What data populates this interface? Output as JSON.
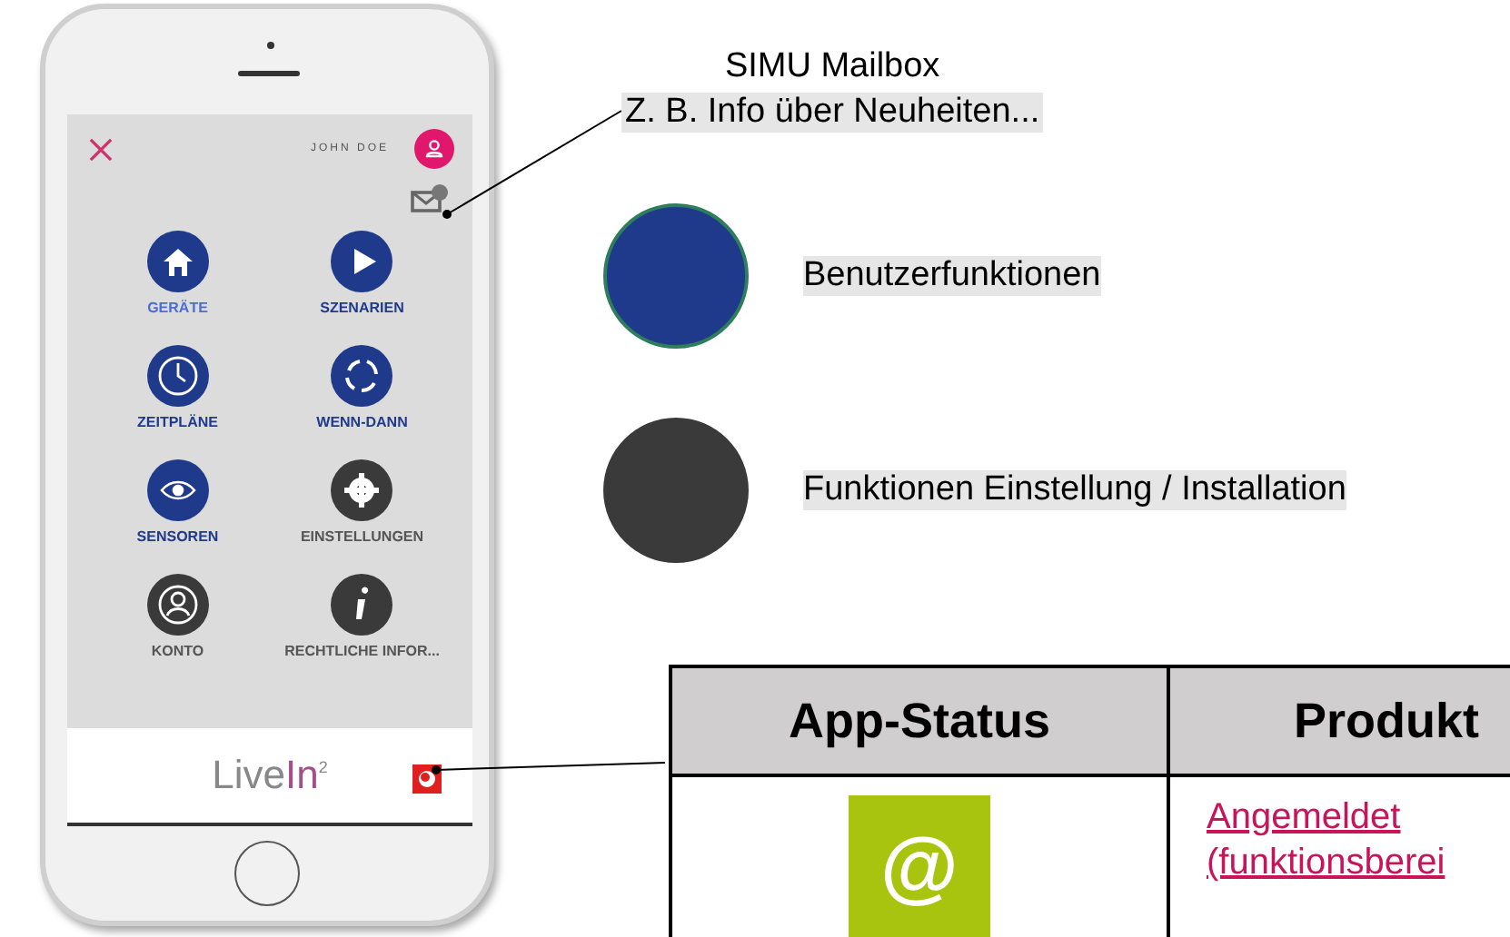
{
  "phone": {
    "header": {
      "user_name": "JOHN DOE"
    },
    "menu": [
      {
        "label": "GERÄTE",
        "kind": "user",
        "selected": true
      },
      {
        "label": "SZENARIEN",
        "kind": "user",
        "selected": false
      },
      {
        "label": "ZEITPLÄNE",
        "kind": "user",
        "selected": false
      },
      {
        "label": "WENN-DANN",
        "kind": "user",
        "selected": false
      },
      {
        "label": "SENSOREN",
        "kind": "user",
        "selected": false
      },
      {
        "label": "EINSTELLUNGEN",
        "kind": "setup",
        "selected": false
      },
      {
        "label": "KONTO",
        "kind": "setup",
        "selected": false
      },
      {
        "label": "RECHTLICHE INFOR...",
        "kind": "setup",
        "selected": false
      }
    ],
    "footer": {
      "logo": [
        "Live",
        "In"
      ],
      "logo_mark": "2"
    }
  },
  "mailbox": {
    "title": "SIMU Mailbox",
    "text": "Z. B. Info über Neuheiten..."
  },
  "legend": [
    {
      "kind": "user",
      "label": "Benutzerfunktionen"
    },
    {
      "kind": "setup",
      "label": "Funktionen Einstellung / Installation"
    }
  ],
  "table": {
    "columns": [
      "App-Status",
      "Produkt"
    ],
    "rows": [
      {
        "status_icon": "@",
        "product": [
          "Angemeldet",
          "(funktionsberei"
        ]
      }
    ]
  }
}
